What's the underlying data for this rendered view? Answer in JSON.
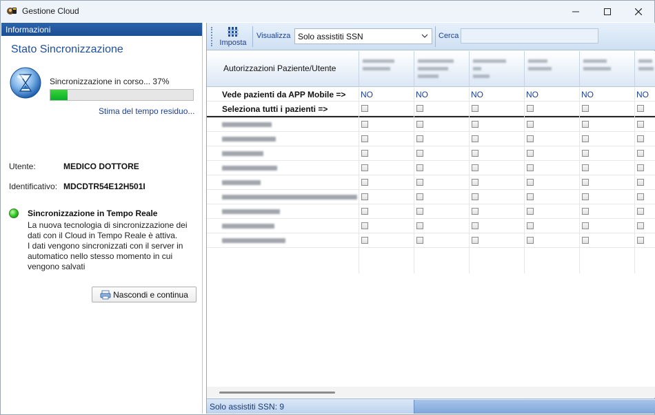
{
  "window": {
    "title": "Gestione Cloud",
    "controls": [
      "minimize-icon",
      "maximize-icon",
      "close-icon"
    ]
  },
  "left_panel": {
    "header": "Informazioni",
    "title": "Stato Sincronizzazione",
    "progress_label": "Sincronizzazione in corso... 37%",
    "progress_percent": 37,
    "progress_fill_fraction": 0.12,
    "eta_link": "Stima del tempo residuo...",
    "user_label": "Utente:",
    "user_value": "MEDICO DOTTORE",
    "id_label": "Identificativo:",
    "id_value": "MDCDTR54E12H501I",
    "realtime_title": "Sincronizzazione in Tempo Reale",
    "realtime_desc": "La nuova tecnologia di sincronizzazione dei dati con il Cloud in Tempo Reale è attiva.\nI dati vengono sincronizzati con il server in automatico nello stesso momento in cui vengono salvati",
    "hide_button": "Nascondi e continua"
  },
  "toolbar": {
    "imposta_label": "Imposta",
    "visualizza_label": "Visualizza",
    "visualizza_value": "Solo assistiti SSN",
    "cerca_label": "Cerca",
    "cerca_value": ""
  },
  "grid": {
    "header_title": "Autorizzazioni Paziente/Utente",
    "app_row_label": "Vede pazienti da APP Mobile =>",
    "app_row_value": "NO",
    "select_all_label": "Seleziona tutti i pazienti =>",
    "column_count": 6,
    "patient_row_count": 9
  },
  "statusbar": {
    "text": "Solo assistiti SSN: 9"
  },
  "colors": {
    "header_blue": "#1d4e94",
    "link_blue": "#1c3f94",
    "progress_green": "#06b025"
  }
}
